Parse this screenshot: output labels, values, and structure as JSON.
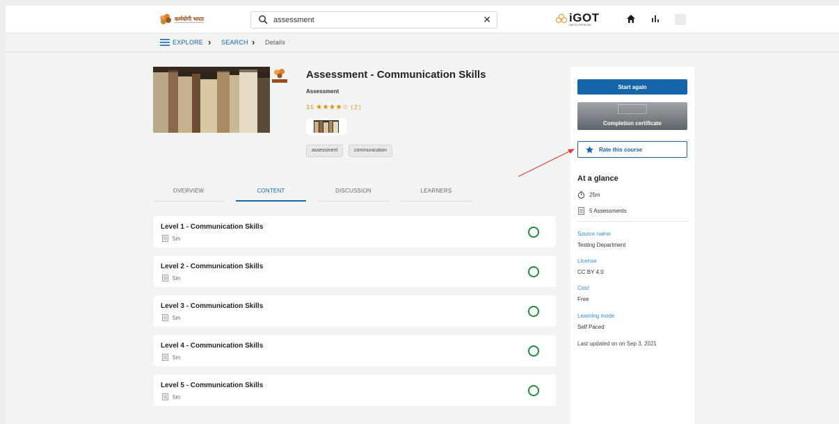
{
  "header": {
    "logo_text": "कर्मयोगी भारत",
    "logo_subtext": "",
    "search": {
      "value": "assessment",
      "placeholder": ""
    },
    "brand": "iGOT",
    "brand_beta": "(BETA VERSION)"
  },
  "breadcrumb": {
    "items": [
      {
        "label": "EXPLORE"
      },
      {
        "label": "SEARCH"
      },
      {
        "label": "Details"
      }
    ]
  },
  "course": {
    "title": "Assessment - Communication Skills",
    "type": "Assessment",
    "rating": "3.5",
    "stars": "★★★★☆",
    "rating_count": "( 2 )",
    "tags": [
      "assessment",
      "communication"
    ]
  },
  "tabs": [
    {
      "label": "OVERVIEW",
      "active": false
    },
    {
      "label": "CONTENT",
      "active": true
    },
    {
      "label": "DISCUSSION",
      "active": false
    },
    {
      "label": "LEARNERS",
      "active": false
    }
  ],
  "content": [
    {
      "name": "Level 1 - Communication Skills",
      "duration": "5m"
    },
    {
      "name": "Level 2 - Communication Skills",
      "duration": "5m"
    },
    {
      "name": "Level 3 - Communication Skills",
      "duration": "5m"
    },
    {
      "name": "Level 4 - Communication Skills",
      "duration": "5m"
    },
    {
      "name": "Level 5 - Communication Skills",
      "duration": "5m"
    }
  ],
  "panel": {
    "start_label": "Start again",
    "certificate_label": "Completion certificate",
    "rate_label": "Rate this course",
    "glance_title": "At a glance",
    "duration": "25m",
    "assessments": "5 Assessments",
    "source_label": "Source name",
    "source_value": "Testing Department",
    "license_label": "License",
    "license_value": "CC BY 4.0",
    "cost_label": "Cost",
    "cost_value": "Free",
    "mode_label": "Learning mode",
    "mode_value": "Self Paced",
    "updated": "Last updated on on Sep 3, 2021"
  },
  "colors": {
    "primary": "#1565a8",
    "complete": "#1e8e3e",
    "rating": "#e08a00",
    "annotation": "#e53935"
  }
}
